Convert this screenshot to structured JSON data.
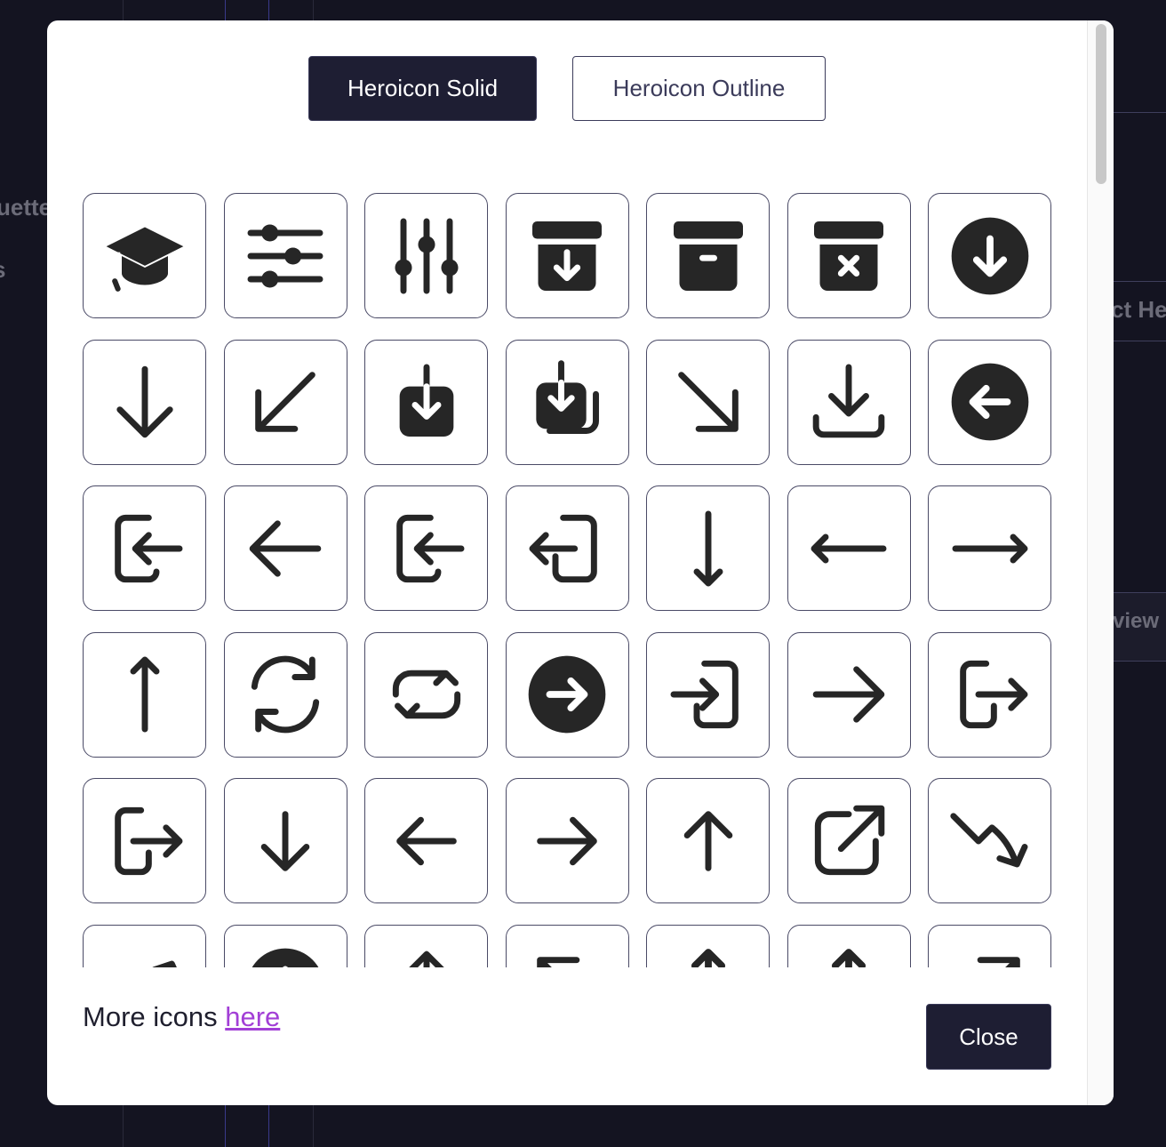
{
  "background": {
    "text_left_1": "uette",
    "text_left_2": "s",
    "text_right_1": "ct He",
    "text_right_2": "view"
  },
  "modal": {
    "tabs": [
      {
        "label": "Heroicon Solid",
        "active": true
      },
      {
        "label": "Heroicon Outline",
        "active": false
      }
    ],
    "icons": [
      "academic-cap-icon",
      "adjustments-horizontal-icon",
      "adjustments-vertical-icon",
      "archive-box-arrow-down-icon",
      "archive-box-icon",
      "archive-box-x-mark-icon",
      "arrow-down-circle-icon",
      "arrow-down-icon",
      "arrow-down-left-icon",
      "arrow-down-on-square-icon",
      "arrow-down-on-square-stack-icon",
      "arrow-down-right-icon",
      "arrow-down-tray-icon",
      "arrow-left-circle-icon",
      "arrow-left-end-on-rectangle-icon",
      "arrow-left-icon",
      "arrow-left-on-rectangle-icon",
      "arrow-left-start-on-rectangle-icon",
      "arrow-long-down-icon",
      "arrow-long-left-icon",
      "arrow-long-right-icon",
      "arrow-long-up-icon",
      "arrow-path-icon",
      "arrow-path-rounded-square-icon",
      "arrow-right-circle-icon",
      "arrow-right-end-on-rectangle-icon",
      "arrow-right-icon",
      "arrow-right-on-rectangle-icon",
      "arrow-right-start-on-rectangle-icon",
      "arrow-small-down-icon",
      "arrow-small-left-icon",
      "arrow-small-right-icon",
      "arrow-small-up-icon",
      "arrow-top-right-on-square-icon",
      "arrow-trending-down-icon",
      "arrow-trending-up-icon",
      "arrow-up-circle-icon",
      "arrow-up-icon",
      "arrow-up-left-icon",
      "arrow-up-on-square-icon",
      "arrow-up-on-square-stack-icon",
      "arrow-up-right-icon"
    ],
    "more_prefix": "More icons ",
    "more_link": "here",
    "close_label": "Close"
  },
  "colors": {
    "primary": "#1e1e33",
    "link": "#a23fd6",
    "border": "#4a4a66",
    "backdrop": "#141421"
  }
}
